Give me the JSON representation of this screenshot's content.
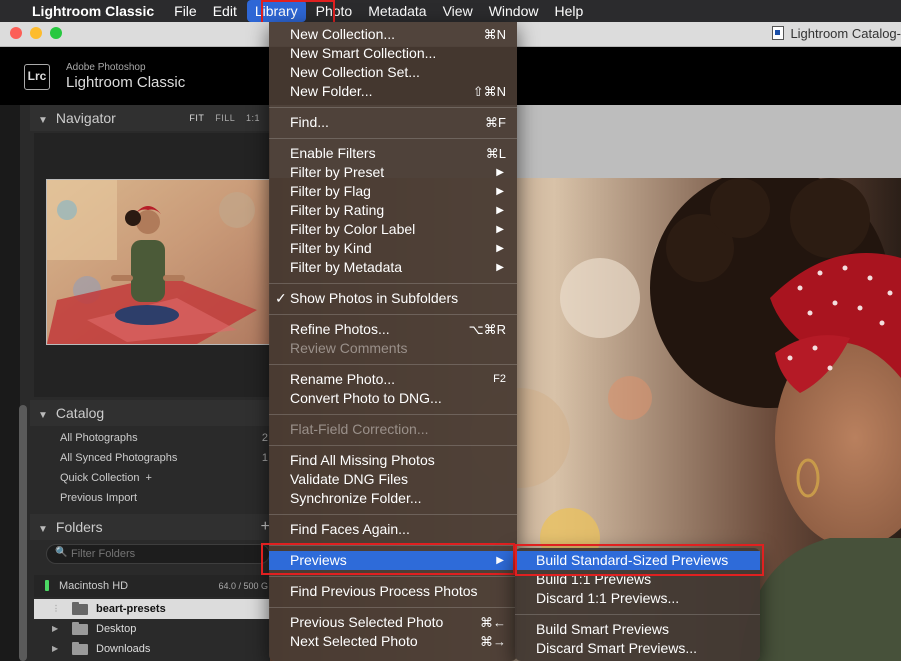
{
  "menubar": {
    "apple_symbol": "",
    "app_name": "Lightroom Classic",
    "items": [
      "File",
      "Edit",
      "Library",
      "Photo",
      "Metadata",
      "View",
      "Window",
      "Help"
    ]
  },
  "window": {
    "title": "Lightroom Catalog-"
  },
  "header": {
    "logo": "Lrc",
    "brand_line1": "Adobe Photoshop",
    "brand_line2": "Lightroom Classic"
  },
  "navigator": {
    "title": "Navigator",
    "modes": [
      "FIT",
      "FILL",
      "1:1"
    ]
  },
  "catalog": {
    "title": "Catalog",
    "items": [
      {
        "label": "All Photographs",
        "count": "2"
      },
      {
        "label": "All Synced Photographs",
        "count": "1"
      },
      {
        "label": "Quick Collection",
        "suffix": "+"
      },
      {
        "label": "Previous Import"
      }
    ]
  },
  "folders": {
    "title": "Folders",
    "add_symbol": "+",
    "search_placeholder": "Filter Folders",
    "volume": {
      "name": "Macintosh HD",
      "capacity": "64.0 / 500 G"
    },
    "items": [
      {
        "name": "beart-presets"
      },
      {
        "name": "Desktop"
      },
      {
        "name": "Downloads"
      }
    ]
  },
  "library_menu": {
    "items": [
      {
        "label": "New Collection...",
        "shortcut": "⌘N"
      },
      {
        "label": "New Smart Collection..."
      },
      {
        "label": "New Collection Set..."
      },
      {
        "label": "New Folder...",
        "shortcut": "⇧⌘N"
      },
      {
        "label": "Find...",
        "shortcut": "⌘F"
      },
      {
        "label": "Enable Filters",
        "shortcut": "⌘L"
      },
      {
        "label": "Filter by Preset",
        "submenu": "▶"
      },
      {
        "label": "Filter by Flag",
        "submenu": "▶"
      },
      {
        "label": "Filter by Rating",
        "submenu": "▶"
      },
      {
        "label": "Filter by Color Label",
        "submenu": "▶"
      },
      {
        "label": "Filter by Kind",
        "submenu": "▶"
      },
      {
        "label": "Filter by Metadata",
        "submenu": "▶"
      },
      {
        "label": "Show Photos in Subfolders",
        "check": "✓"
      },
      {
        "label": "Refine Photos...",
        "shortcut": "⌥⌘R"
      },
      {
        "label": "Review Comments"
      },
      {
        "label": "Rename Photo...",
        "shortcut": "F2"
      },
      {
        "label": "Convert Photo to DNG..."
      },
      {
        "label": "Flat-Field Correction..."
      },
      {
        "label": "Find All Missing Photos"
      },
      {
        "label": "Validate DNG Files"
      },
      {
        "label": "Synchronize Folder..."
      },
      {
        "label": "Find Faces Again..."
      },
      {
        "label": "Previews",
        "submenu": "▶"
      },
      {
        "label": "Find Previous Process Photos"
      },
      {
        "label": "Previous Selected Photo",
        "shortcut": "⌘←"
      },
      {
        "label": "Next Selected Photo",
        "shortcut": "⌘→"
      }
    ]
  },
  "previews_menu": {
    "items": [
      {
        "label": "Build Standard-Sized Previews"
      },
      {
        "label": "Build 1:1 Previews"
      },
      {
        "label": "Discard 1:1 Previews..."
      },
      {
        "label": "Build Smart Previews"
      },
      {
        "label": "Discard Smart Previews..."
      }
    ]
  },
  "colors": {
    "menu_highlight": "#2e6bd9",
    "annotation_red": "#e02020",
    "menubar_bg": "#2b2b2d",
    "panel_bg": "#2a2a2a",
    "volume_ok": "#4cd964"
  }
}
